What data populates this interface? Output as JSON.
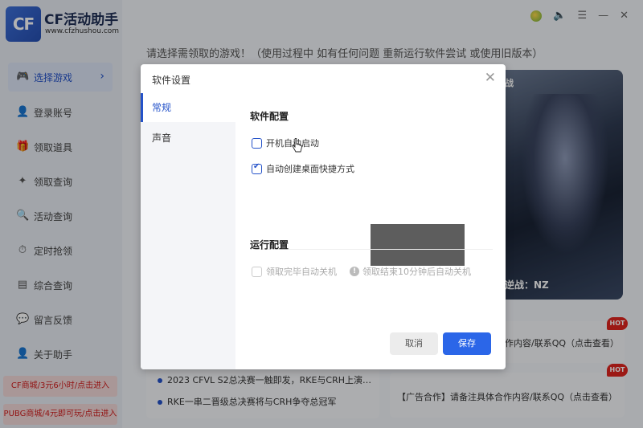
{
  "app": {
    "logo_text": "CF",
    "title": "CF活动助手",
    "url": "www.cfzhushou.com",
    "hint": "请选择需领取的游戏！（使用过程中  如有任何问题  重新运行软件尝试  或使用旧版本）"
  },
  "sidebar": {
    "items": [
      {
        "label": "选择游戏",
        "icon": "gamepad-icon",
        "glyph": "🎮",
        "active": true
      },
      {
        "label": "登录账号",
        "icon": "user-icon",
        "glyph": "👤"
      },
      {
        "label": "领取道具",
        "icon": "gift-icon",
        "glyph": "🎁"
      },
      {
        "label": "领取查询",
        "icon": "search-list-icon",
        "glyph": "✦"
      },
      {
        "label": "活动查询",
        "icon": "activity-icon",
        "glyph": "🔍"
      },
      {
        "label": "定时抢领",
        "icon": "timer-icon",
        "glyph": "⏱"
      },
      {
        "label": "综合查询",
        "icon": "document-icon",
        "glyph": "▤"
      },
      {
        "label": "留言反馈",
        "icon": "chat-icon",
        "glyph": "💬"
      },
      {
        "label": "关于助手",
        "icon": "person-icon",
        "glyph": "👤"
      }
    ],
    "promos": [
      "CF商城/3元6小时/点击进入",
      "PUBG商城/4元即可玩/点击进入"
    ]
  },
  "banner": {
    "top_char": "战",
    "caption": "逆战：NZ"
  },
  "news": [
    "2023 CFVL S2总决赛一触即发，RKE与CRH上演…",
    "RKE一串二晋级总决赛将与CRH争夺总冠军"
  ],
  "ads": [
    "作内容/联系QQ（点击查看）",
    "【广告合作】请备注具体合作内容/联系QQ（点击查看）"
  ],
  "hot_label": "HOT",
  "dialog": {
    "title": "软件设置",
    "close_glyph": "✕",
    "tabs": [
      {
        "label": "常规",
        "active": true
      },
      {
        "label": "声音",
        "active": false
      }
    ],
    "section1_title": "软件配置",
    "section1_options": [
      {
        "label": "开机自动启动",
        "checked": false
      },
      {
        "label": "自动创建桌面快捷方式",
        "checked": true
      }
    ],
    "section2_title": "运行配置",
    "section2_option": {
      "label": "领取完毕自动关机",
      "checked": false,
      "disabled": true
    },
    "info_hint": "领取结束10分钟后自动关机",
    "cancel_label": "取消",
    "save_label": "保存"
  },
  "colors": {
    "accent": "#2452c9",
    "save_button": "#2b66e8",
    "promo_text": "#d11d1d",
    "hot_badge": "#e0251f"
  }
}
